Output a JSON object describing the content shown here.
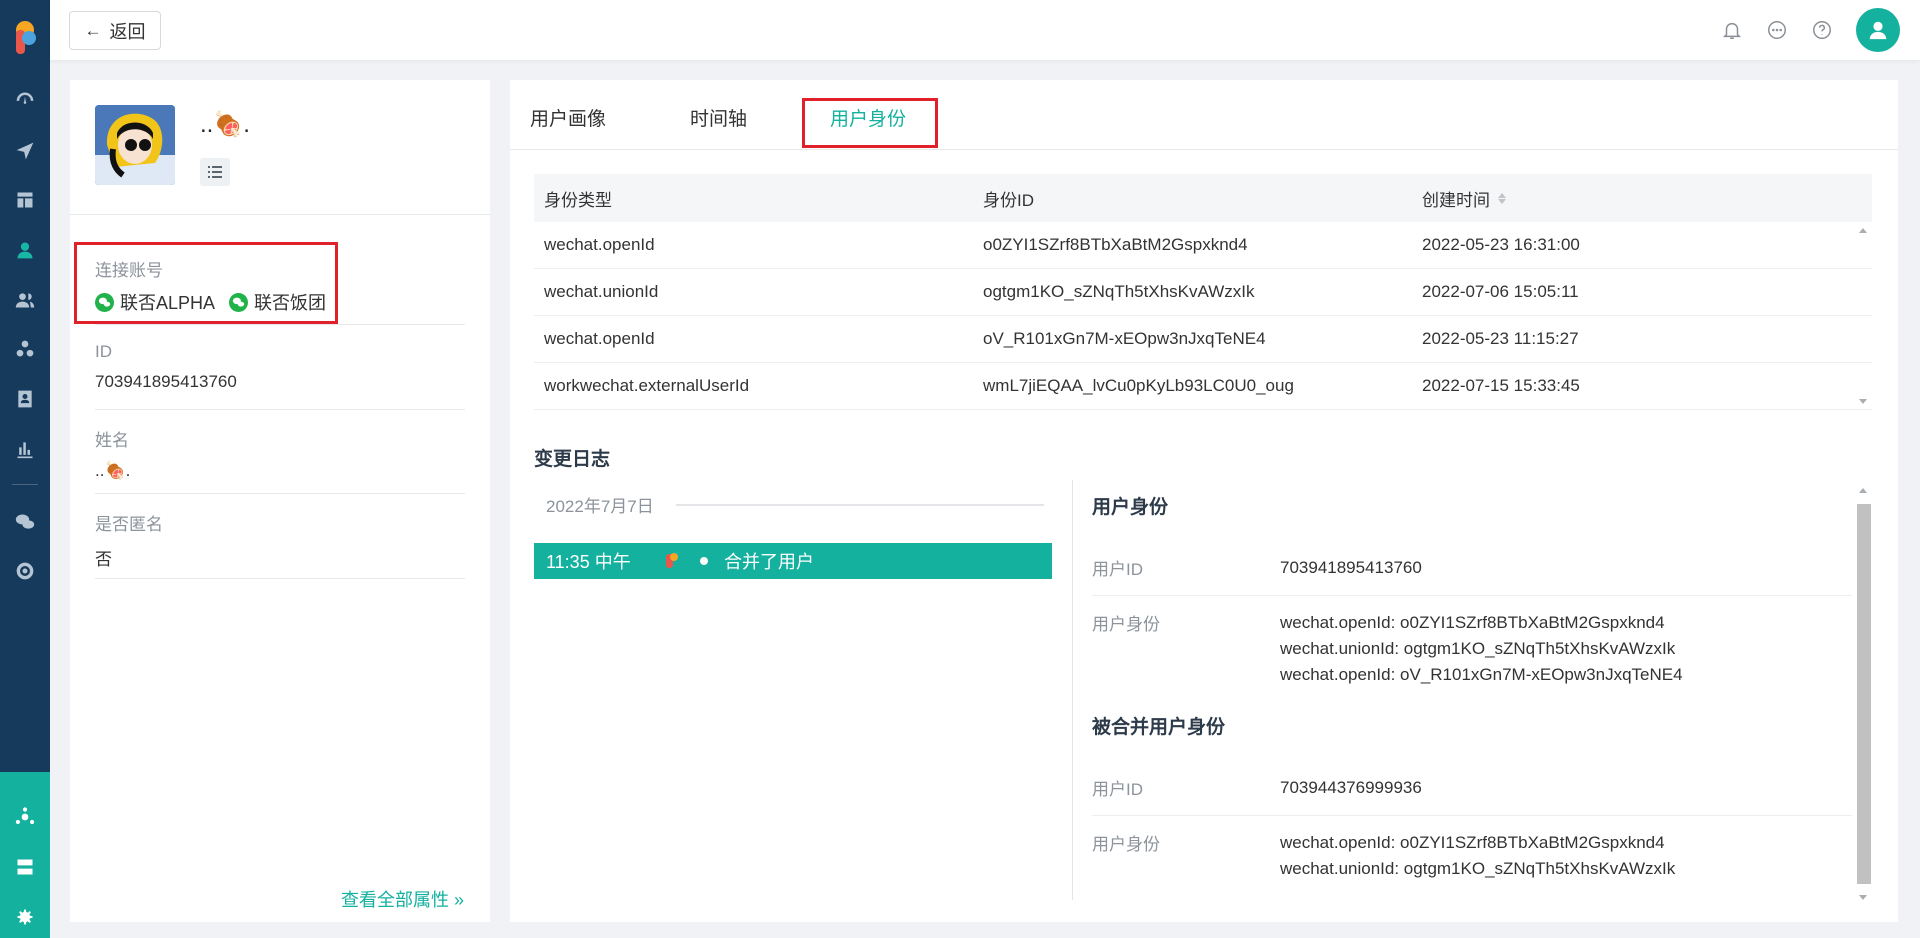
{
  "header": {
    "back_label": "返回",
    "icons": [
      "bell-icon",
      "chat-icon",
      "help-icon",
      "user-avatar-icon"
    ]
  },
  "sidebar": {
    "icons": [
      "dashboard-icon",
      "send-icon",
      "layout-icon",
      "user-icon",
      "users-icon",
      "segment-icon",
      "badge-icon",
      "chart-icon",
      "wechat-icon",
      "target-icon",
      "network-icon",
      "server-icon",
      "settings-icon"
    ],
    "active": "user-icon"
  },
  "profile": {
    "name": "..🍖.",
    "connected_label": "连接账号",
    "accounts": [
      "联否ALPHA",
      "联否饭团"
    ],
    "id_label": "ID",
    "id_value": "703941895413760",
    "name_label": "姓名",
    "name_value": "..🍖.",
    "anon_label": "是否匿名",
    "anon_value": "否",
    "view_all": "查看全部属性 »"
  },
  "tabs": [
    "用户画像",
    "时间轴",
    "用户身份"
  ],
  "active_tab": "用户身份",
  "identity_table": {
    "columns": [
      "身份类型",
      "身份ID",
      "创建时间"
    ],
    "rows": [
      [
        "wechat.openId",
        "o0ZYI1SZrf8BTbXaBtM2Gspxknd4",
        "2022-05-23 16:31:00"
      ],
      [
        "wechat.unionId",
        "ogtgm1KO_sZNqTh5tXhsKvAWzxIk",
        "2022-07-06 15:05:11"
      ],
      [
        "wechat.openId",
        "oV_R101xGn7M-xEOpw3nJxqTeNE4",
        "2022-05-23 11:15:27"
      ],
      [
        "workwechat.externalUserId",
        "wmL7jiEQAA_lvCu0pKyLb93LC0U0_oug",
        "2022-07-15 15:33:45"
      ]
    ]
  },
  "changelog": {
    "title": "变更日志",
    "date": "2022年7月7日",
    "item_time": "11:35 中午",
    "item_text": "合并了用户",
    "detail": {
      "section1_title": "用户身份",
      "user_id_label": "用户ID",
      "user_id_value": "703941895413760",
      "identity_label": "用户身份",
      "identity_values": [
        "wechat.openId: o0ZYI1SZrf8BTbXaBtM2Gspxknd4",
        "wechat.unionId: ogtgm1KO_sZNqTh5tXhsKvAWzxIk",
        "wechat.openId: oV_R101xGn7M-xEOpw3nJxqTeNE4"
      ],
      "section2_title": "被合并用户身份",
      "merged_user_id_label": "用户ID",
      "merged_user_id_value": "703944376999936",
      "merged_identity_label": "用户身份",
      "merged_identity_values": [
        "wechat.openId: o0ZYI1SZrf8BTbXaBtM2Gspxknd4",
        "wechat.unionId: ogtgm1KO_sZNqTh5tXhsKvAWzxIk"
      ]
    }
  },
  "colors": {
    "accent": "#14b19f",
    "sidebar": "#163a5c",
    "highlight_box": "#e0202a",
    "wechat_green": "#21b34a"
  }
}
